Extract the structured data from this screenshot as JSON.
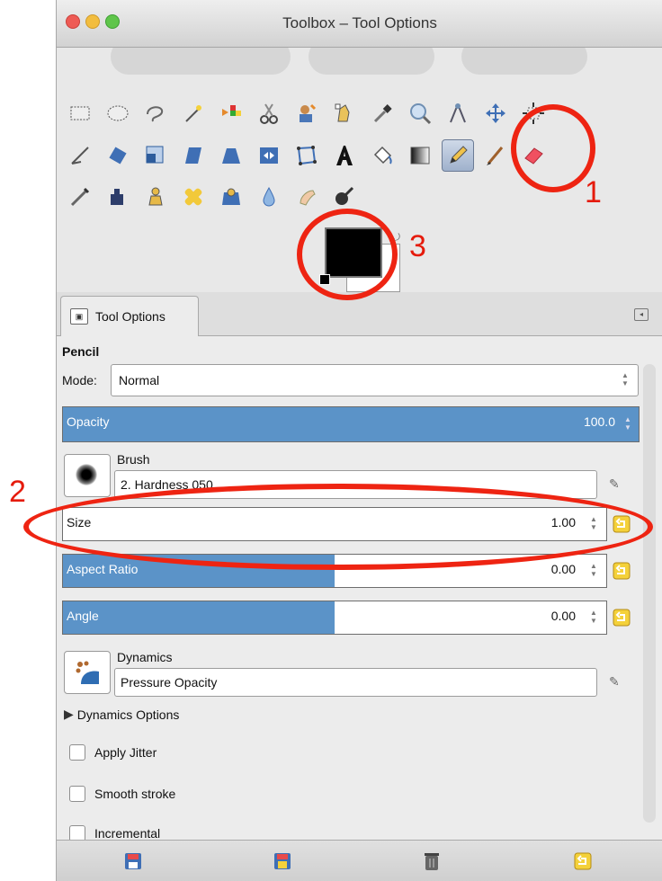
{
  "window": {
    "title": "Toolbox – Tool Options"
  },
  "tabs": [
    {
      "label": "Tool Options"
    }
  ],
  "tool_options": {
    "tool_name": "Pencil",
    "mode": {
      "label": "Mode:",
      "value": "Normal"
    },
    "opacity": {
      "label": "Opacity",
      "value": "100.0",
      "fraction": 1.0
    },
    "brush": {
      "label": "Brush",
      "value": "2. Hardness 050"
    },
    "size": {
      "label": "Size",
      "value": "1.00",
      "fraction": 0.0
    },
    "aspect_ratio": {
      "label": "Aspect Ratio",
      "value": "0.00",
      "fraction": 0.5
    },
    "angle": {
      "label": "Angle",
      "value": "0.00",
      "fraction": 0.5
    },
    "dynamics": {
      "label": "Dynamics",
      "value": "Pressure Opacity"
    },
    "dynamics_options": {
      "label": "Dynamics Options"
    },
    "checkboxes": [
      {
        "label": "Apply Jitter",
        "checked": false
      },
      {
        "label": "Smooth stroke",
        "checked": false
      },
      {
        "label": "Incremental",
        "checked": false
      }
    ]
  },
  "annotations": [
    {
      "label": "1"
    },
    {
      "label": "2"
    },
    {
      "label": "3"
    }
  ],
  "colors": {
    "accent_fill": "#5b93c8",
    "annotation": "#ee2412",
    "foreground_color": "#000000",
    "background_color": "#ffffff"
  },
  "icons": {
    "tools_row1": [
      "rect-select-icon",
      "ellipse-select-icon",
      "free-select-icon",
      "fuzzy-select-icon",
      "select-by-color-icon",
      "scissors-icon",
      "foreground-select-icon",
      "paths-icon",
      "color-picker-icon",
      "zoom-icon",
      "measure-icon",
      "move-icon",
      "align-icon"
    ],
    "tools_row2": [
      "crop-icon",
      "rotate-icon",
      "scale-icon",
      "shear-icon",
      "perspective-icon",
      "flip-icon",
      "cage-icon",
      "text-icon",
      "bucket-fill-icon",
      "blend-icon",
      "pencil-icon",
      "paintbrush-icon",
      "eraser-icon"
    ],
    "tools_row3": [
      "airbrush-icon",
      "ink-icon",
      "clone-icon",
      "heal-icon",
      "perspective-clone-icon",
      "blur-icon",
      "smudge-icon",
      "dodge-burn-icon"
    ],
    "bottom": [
      "save-preset-icon",
      "restore-preset-icon",
      "delete-preset-icon",
      "reset-icon"
    ]
  }
}
